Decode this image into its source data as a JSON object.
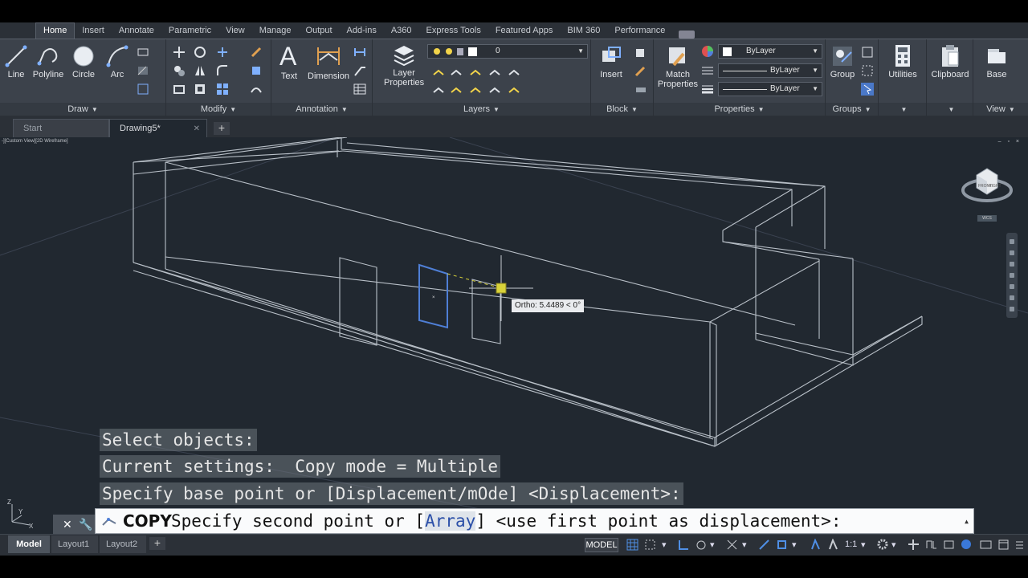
{
  "ribbon_tabs": [
    "Home",
    "Insert",
    "Annotate",
    "Parametric",
    "View",
    "Manage",
    "Output",
    "Add-ins",
    "A360",
    "Express Tools",
    "Featured Apps",
    "BIM 360",
    "Performance"
  ],
  "active_tab": "Home",
  "panels": {
    "draw": {
      "title": "Draw",
      "tools": [
        "Line",
        "Polyline",
        "Circle",
        "Arc"
      ]
    },
    "modify": {
      "title": "Modify"
    },
    "annotation": {
      "title": "Annotation",
      "tools": [
        "Text",
        "Dimension"
      ]
    },
    "layers": {
      "title": "Layers",
      "tool": "Layer\nProperties",
      "tool_line1": "Layer",
      "tool_line2": "Properties",
      "current_layer": "0"
    },
    "block": {
      "title": "Block",
      "tool": "Insert"
    },
    "properties": {
      "title": "Properties",
      "tool_line1": "Match",
      "tool_line2": "Properties",
      "color": "ByLayer",
      "linetype": "ByLayer",
      "lineweight": "ByLayer"
    },
    "groups": {
      "title": "Groups",
      "tool": "Group"
    },
    "utilities": {
      "tool": "Utilities"
    },
    "clipboard": {
      "tool": "Clipboard"
    },
    "view": {
      "title": "View",
      "tool": "Base"
    }
  },
  "file_tabs": [
    {
      "label": "Start"
    },
    {
      "label": "Drawing5*"
    }
  ],
  "viewport": {
    "label": "-][Custom View][2D Wireframe]",
    "controls": "– ▫ ×",
    "wcs_label": "WCS",
    "ortho_tooltip": "Ortho: 5.4489 < 0°"
  },
  "command_history": [
    "Select objects:",
    "Current settings:  Copy mode = Multiple",
    "Specify base point or [Displacement/mOde] <Displacement>:"
  ],
  "command_line": {
    "command": "COPY",
    "prompt_before": "Specify second point or [",
    "highlight_letter": "A",
    "highlight_rest": "rray",
    "prompt_after": "] <use first point as displacement>:"
  },
  "status_bar": {
    "layout_tabs": [
      "Model",
      "Layout1",
      "Layout2"
    ],
    "space": "MODEL",
    "scale": "1:1"
  },
  "colors": {
    "viewport_bg": "#212830",
    "ribbon_bg": "#3c424b",
    "selected_object": "#4f7fd6",
    "grip_point": "#d8d23a"
  }
}
